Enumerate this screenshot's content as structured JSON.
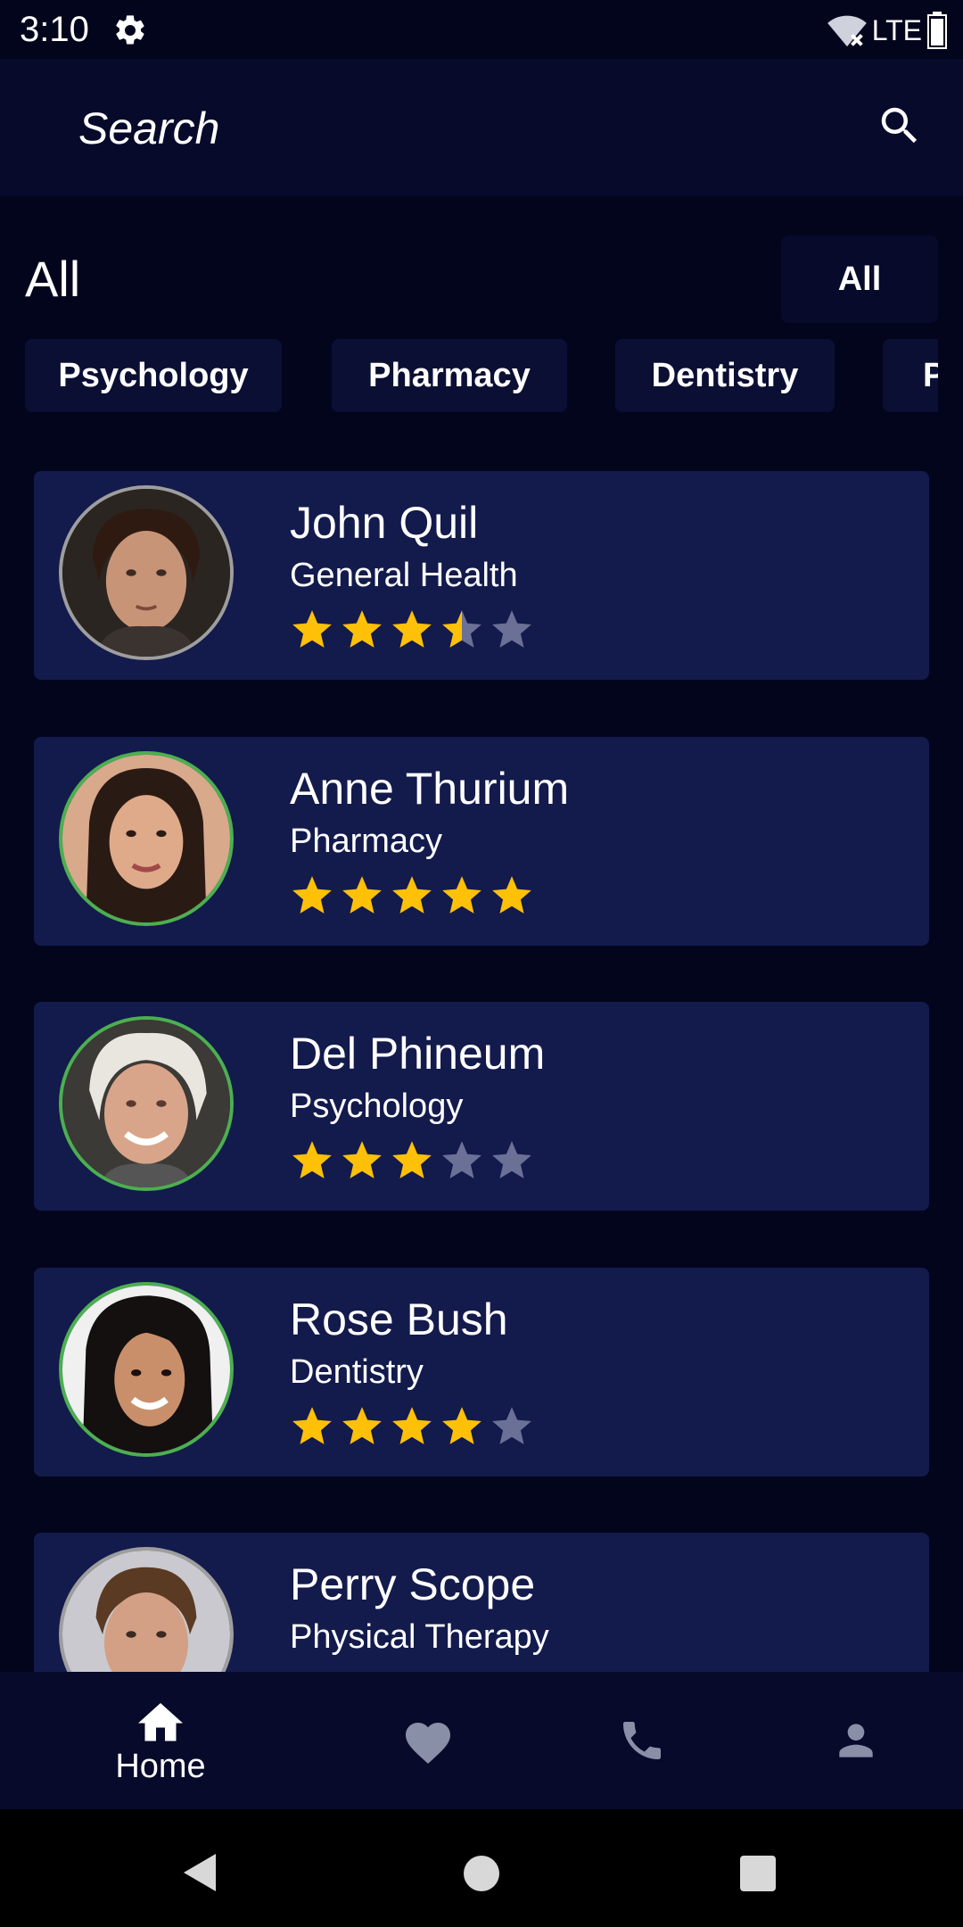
{
  "status": {
    "time": "3:10",
    "network": "LTE"
  },
  "search": {
    "placeholder": "Search"
  },
  "section": {
    "title": "All",
    "filter_button": "All"
  },
  "categories": [
    "Psychology",
    "Pharmacy",
    "Dentistry",
    "Physical Therapy"
  ],
  "doctors": [
    {
      "name": "John Quil",
      "specialty": "General Health",
      "rating": 3.5,
      "ring": "#9e9e9e"
    },
    {
      "name": "Anne Thurium",
      "specialty": "Pharmacy",
      "rating": 5,
      "ring": "#4caf50"
    },
    {
      "name": "Del Phineum",
      "specialty": "Psychology",
      "rating": 3,
      "ring": "#4caf50"
    },
    {
      "name": "Rose Bush",
      "specialty": "Dentistry",
      "rating": 4,
      "ring": "#4caf50"
    },
    {
      "name": "Perry Scope",
      "specialty": "Physical Therapy",
      "rating": null,
      "ring": "#9e9e9e"
    }
  ],
  "nav": [
    {
      "label": "Home",
      "icon": "home-icon",
      "active": true
    },
    {
      "label": "",
      "icon": "heart-icon",
      "active": false
    },
    {
      "label": "",
      "icon": "phone-icon",
      "active": false
    },
    {
      "label": "",
      "icon": "person-icon",
      "active": false
    }
  ],
  "colors": {
    "star_filled": "#ffc107",
    "star_empty": "#6b7096",
    "inactive_icon": "#8a8fa8"
  }
}
